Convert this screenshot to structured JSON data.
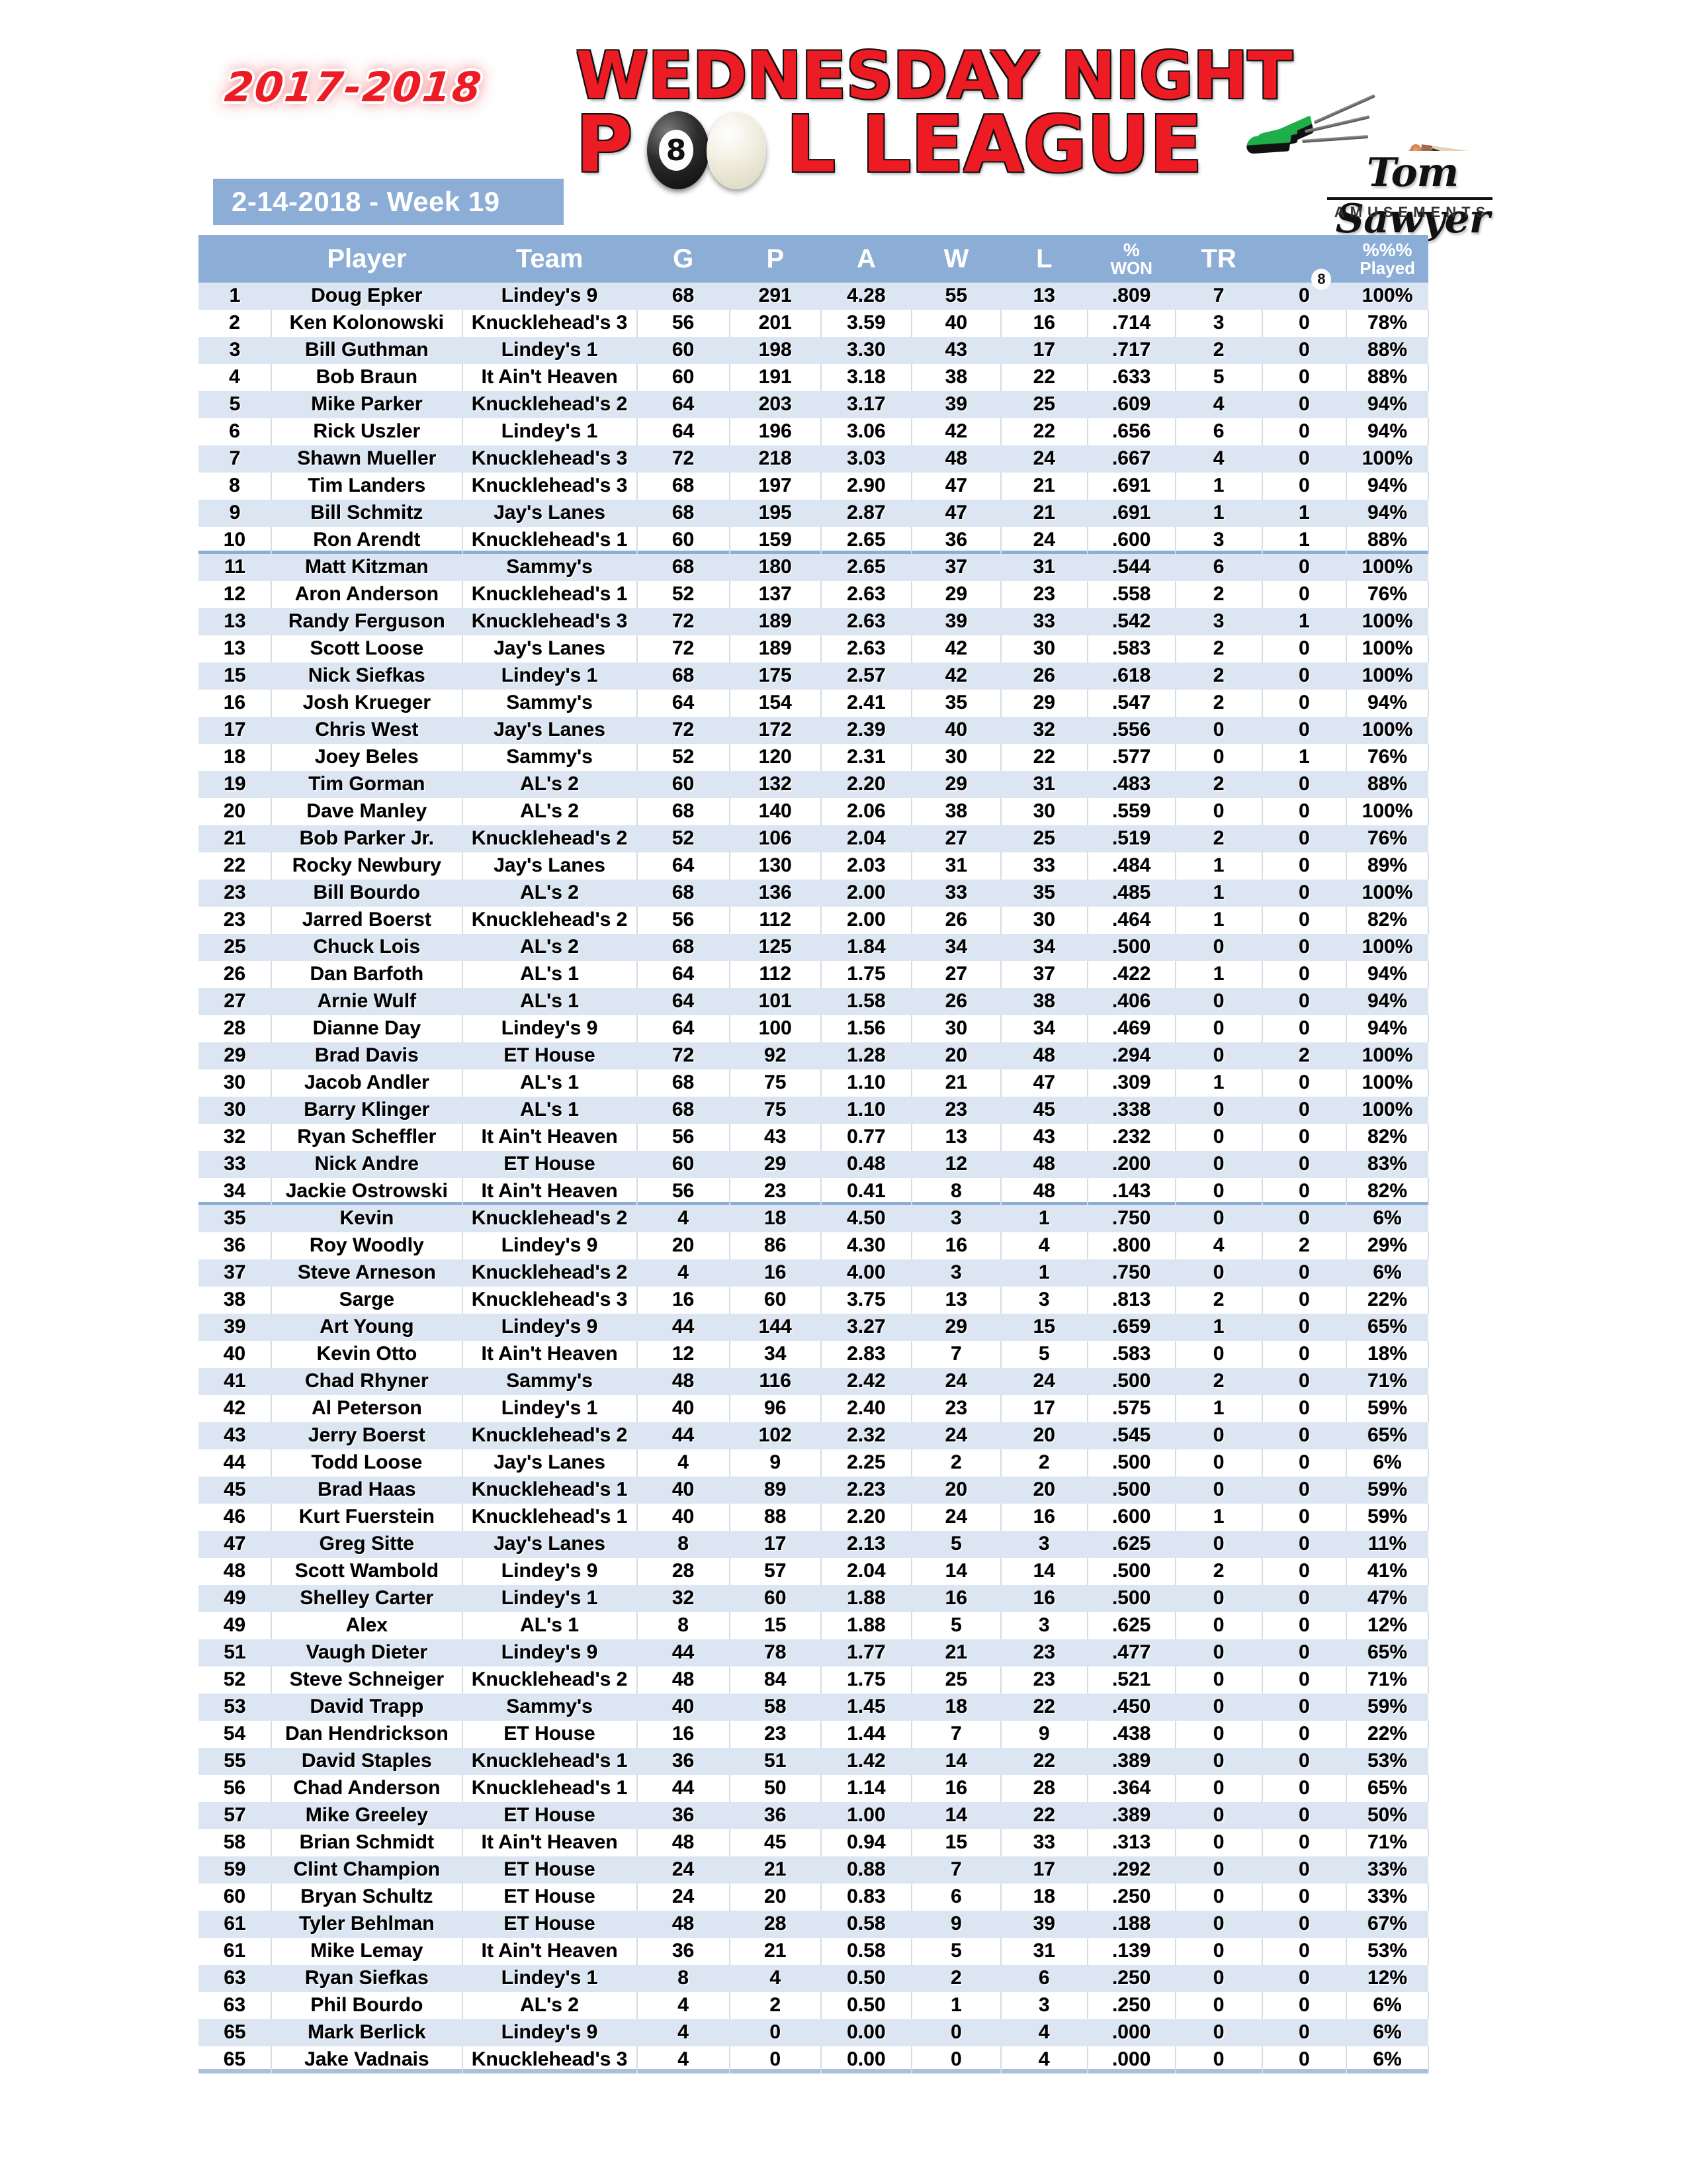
{
  "header": {
    "season": "2017-2018",
    "date_banner": "2-14-2018 - Week 19",
    "title_line1": "WEDNESDAY NIGHT",
    "title_p": "P",
    "title_l_league": "L LEAGUE",
    "eightball_number": "8",
    "logo": {
      "name": "Tom Sawyer",
      "subtitle": "AMUSEMENTS"
    },
    "colors": {
      "accent_red": "#ED1C24",
      "header_blue": "#8CAED6",
      "row_alt_blue": "#DCE6F2"
    }
  },
  "table": {
    "columns": [
      {
        "key": "rank",
        "label": ""
      },
      {
        "key": "player",
        "label": "Player"
      },
      {
        "key": "team",
        "label": "Team"
      },
      {
        "key": "g",
        "label": "G"
      },
      {
        "key": "p",
        "label": "P"
      },
      {
        "key": "a",
        "label": "A"
      },
      {
        "key": "w",
        "label": "W"
      },
      {
        "key": "l",
        "label": "L"
      },
      {
        "key": "won",
        "label_top": "%",
        "label_bottom": "WON"
      },
      {
        "key": "tr",
        "label": "TR"
      },
      {
        "key": "eb",
        "label": "8"
      },
      {
        "key": "pl",
        "label_top": "%%%",
        "label_bottom": "Played"
      }
    ],
    "rows": [
      {
        "rank": "1",
        "player": "Doug Epker",
        "team": "Lindey's 9",
        "g": "68",
        "p": "291",
        "a": "4.28",
        "w": "55",
        "l": "13",
        "won": ".809",
        "tr": "7",
        "eb": "0",
        "pl": "100%"
      },
      {
        "rank": "2",
        "player": "Ken Kolonowski",
        "team": "Knucklehead's 3",
        "g": "56",
        "p": "201",
        "a": "3.59",
        "w": "40",
        "l": "16",
        "won": ".714",
        "tr": "3",
        "eb": "0",
        "pl": "78%"
      },
      {
        "rank": "3",
        "player": "Bill Guthman",
        "team": "Lindey's 1",
        "g": "60",
        "p": "198",
        "a": "3.30",
        "w": "43",
        "l": "17",
        "won": ".717",
        "tr": "2",
        "eb": "0",
        "pl": "88%"
      },
      {
        "rank": "4",
        "player": "Bob Braun",
        "team": "It Ain't Heaven",
        "g": "60",
        "p": "191",
        "a": "3.18",
        "w": "38",
        "l": "22",
        "won": ".633",
        "tr": "5",
        "eb": "0",
        "pl": "88%"
      },
      {
        "rank": "5",
        "player": "Mike Parker",
        "team": "Knucklehead's 2",
        "g": "64",
        "p": "203",
        "a": "3.17",
        "w": "39",
        "l": "25",
        "won": ".609",
        "tr": "4",
        "eb": "0",
        "pl": "94%"
      },
      {
        "rank": "6",
        "player": "Rick Uszler",
        "team": "Lindey's 1",
        "g": "64",
        "p": "196",
        "a": "3.06",
        "w": "42",
        "l": "22",
        "won": ".656",
        "tr": "6",
        "eb": "0",
        "pl": "94%"
      },
      {
        "rank": "7",
        "player": "Shawn Mueller",
        "team": "Knucklehead's 3",
        "g": "72",
        "p": "218",
        "a": "3.03",
        "w": "48",
        "l": "24",
        "won": ".667",
        "tr": "4",
        "eb": "0",
        "pl": "100%"
      },
      {
        "rank": "8",
        "player": "Tim Landers",
        "team": "Knucklehead's 3",
        "g": "68",
        "p": "197",
        "a": "2.90",
        "w": "47",
        "l": "21",
        "won": ".691",
        "tr": "1",
        "eb": "0",
        "pl": "94%"
      },
      {
        "rank": "9",
        "player": "Bill Schmitz",
        "team": "Jay's Lanes",
        "g": "68",
        "p": "195",
        "a": "2.87",
        "w": "47",
        "l": "21",
        "won": ".691",
        "tr": "1",
        "eb": "1",
        "pl": "94%"
      },
      {
        "rank": "10",
        "player": "Ron Arendt",
        "team": "Knucklehead's 1",
        "g": "60",
        "p": "159",
        "a": "2.65",
        "w": "36",
        "l": "24",
        "won": ".600",
        "tr": "3",
        "eb": "1",
        "pl": "88%",
        "band_end": true
      },
      {
        "rank": "11",
        "player": "Matt Kitzman",
        "team": "Sammy's",
        "g": "68",
        "p": "180",
        "a": "2.65",
        "w": "37",
        "l": "31",
        "won": ".544",
        "tr": "6",
        "eb": "0",
        "pl": "100%"
      },
      {
        "rank": "12",
        "player": "Aron Anderson",
        "team": "Knucklehead's 1",
        "g": "52",
        "p": "137",
        "a": "2.63",
        "w": "29",
        "l": "23",
        "won": ".558",
        "tr": "2",
        "eb": "0",
        "pl": "76%"
      },
      {
        "rank": "13",
        "player": "Randy Ferguson",
        "team": "Knucklehead's 3",
        "g": "72",
        "p": "189",
        "a": "2.63",
        "w": "39",
        "l": "33",
        "won": ".542",
        "tr": "3",
        "eb": "1",
        "pl": "100%"
      },
      {
        "rank": "13",
        "player": "Scott Loose",
        "team": "Jay's Lanes",
        "g": "72",
        "p": "189",
        "a": "2.63",
        "w": "42",
        "l": "30",
        "won": ".583",
        "tr": "2",
        "eb": "0",
        "pl": "100%"
      },
      {
        "rank": "15",
        "player": "Nick Siefkas",
        "team": "Lindey's 1",
        "g": "68",
        "p": "175",
        "a": "2.57",
        "w": "42",
        "l": "26",
        "won": ".618",
        "tr": "2",
        "eb": "0",
        "pl": "100%"
      },
      {
        "rank": "16",
        "player": "Josh Krueger",
        "team": "Sammy's",
        "g": "64",
        "p": "154",
        "a": "2.41",
        "w": "35",
        "l": "29",
        "won": ".547",
        "tr": "2",
        "eb": "0",
        "pl": "94%"
      },
      {
        "rank": "17",
        "player": "Chris West",
        "team": "Jay's Lanes",
        "g": "72",
        "p": "172",
        "a": "2.39",
        "w": "40",
        "l": "32",
        "won": ".556",
        "tr": "0",
        "eb": "0",
        "pl": "100%"
      },
      {
        "rank": "18",
        "player": "Joey Beles",
        "team": "Sammy's",
        "g": "52",
        "p": "120",
        "a": "2.31",
        "w": "30",
        "l": "22",
        "won": ".577",
        "tr": "0",
        "eb": "1",
        "pl": "76%"
      },
      {
        "rank": "19",
        "player": "Tim Gorman",
        "team": "AL's 2",
        "g": "60",
        "p": "132",
        "a": "2.20",
        "w": "29",
        "l": "31",
        "won": ".483",
        "tr": "2",
        "eb": "0",
        "pl": "88%"
      },
      {
        "rank": "20",
        "player": "Dave Manley",
        "team": "AL's 2",
        "g": "68",
        "p": "140",
        "a": "2.06",
        "w": "38",
        "l": "30",
        "won": ".559",
        "tr": "0",
        "eb": "0",
        "pl": "100%"
      },
      {
        "rank": "21",
        "player": "Bob Parker Jr.",
        "team": "Knucklehead's 2",
        "g": "52",
        "p": "106",
        "a": "2.04",
        "w": "27",
        "l": "25",
        "won": ".519",
        "tr": "2",
        "eb": "0",
        "pl": "76%"
      },
      {
        "rank": "22",
        "player": "Rocky Newbury",
        "team": "Jay's Lanes",
        "g": "64",
        "p": "130",
        "a": "2.03",
        "w": "31",
        "l": "33",
        "won": ".484",
        "tr": "1",
        "eb": "0",
        "pl": "89%"
      },
      {
        "rank": "23",
        "player": "Bill Bourdo",
        "team": "AL's 2",
        "g": "68",
        "p": "136",
        "a": "2.00",
        "w": "33",
        "l": "35",
        "won": ".485",
        "tr": "1",
        "eb": "0",
        "pl": "100%"
      },
      {
        "rank": "23",
        "player": "Jarred Boerst",
        "team": "Knucklehead's 2",
        "g": "56",
        "p": "112",
        "a": "2.00",
        "w": "26",
        "l": "30",
        "won": ".464",
        "tr": "1",
        "eb": "0",
        "pl": "82%"
      },
      {
        "rank": "25",
        "player": "Chuck Lois",
        "team": "AL's 2",
        "g": "68",
        "p": "125",
        "a": "1.84",
        "w": "34",
        "l": "34",
        "won": ".500",
        "tr": "0",
        "eb": "0",
        "pl": "100%"
      },
      {
        "rank": "26",
        "player": "Dan Barfoth",
        "team": "AL's 1",
        "g": "64",
        "p": "112",
        "a": "1.75",
        "w": "27",
        "l": "37",
        "won": ".422",
        "tr": "1",
        "eb": "0",
        "pl": "94%"
      },
      {
        "rank": "27",
        "player": "Arnie Wulf",
        "team": "AL's 1",
        "g": "64",
        "p": "101",
        "a": "1.58",
        "w": "26",
        "l": "38",
        "won": ".406",
        "tr": "0",
        "eb": "0",
        "pl": "94%"
      },
      {
        "rank": "28",
        "player": "Dianne Day",
        "team": "Lindey's 9",
        "g": "64",
        "p": "100",
        "a": "1.56",
        "w": "30",
        "l": "34",
        "won": ".469",
        "tr": "0",
        "eb": "0",
        "pl": "94%"
      },
      {
        "rank": "29",
        "player": "Brad Davis",
        "team": "ET House",
        "g": "72",
        "p": "92",
        "a": "1.28",
        "w": "20",
        "l": "48",
        "won": ".294",
        "tr": "0",
        "eb": "2",
        "pl": "100%"
      },
      {
        "rank": "30",
        "player": "Jacob Andler",
        "team": "AL's 1",
        "g": "68",
        "p": "75",
        "a": "1.10",
        "w": "21",
        "l": "47",
        "won": ".309",
        "tr": "1",
        "eb": "0",
        "pl": "100%"
      },
      {
        "rank": "30",
        "player": "Barry Klinger",
        "team": "AL's 1",
        "g": "68",
        "p": "75",
        "a": "1.10",
        "w": "23",
        "l": "45",
        "won": ".338",
        "tr": "0",
        "eb": "0",
        "pl": "100%"
      },
      {
        "rank": "32",
        "player": "Ryan Scheffler",
        "team": "It Ain't Heaven",
        "g": "56",
        "p": "43",
        "a": "0.77",
        "w": "13",
        "l": "43",
        "won": ".232",
        "tr": "0",
        "eb": "0",
        "pl": "82%"
      },
      {
        "rank": "33",
        "player": "Nick Andre",
        "team": "ET House",
        "g": "60",
        "p": "29",
        "a": "0.48",
        "w": "12",
        "l": "48",
        "won": ".200",
        "tr": "0",
        "eb": "0",
        "pl": "83%"
      },
      {
        "rank": "34",
        "player": "Jackie Ostrowski",
        "team": "It Ain't Heaven",
        "g": "56",
        "p": "23",
        "a": "0.41",
        "w": "8",
        "l": "48",
        "won": ".143",
        "tr": "0",
        "eb": "0",
        "pl": "82%",
        "band_end": true
      },
      {
        "rank": "35",
        "player": "Kevin",
        "team": "Knucklehead's 2",
        "g": "4",
        "p": "18",
        "a": "4.50",
        "w": "3",
        "l": "1",
        "won": ".750",
        "tr": "0",
        "eb": "0",
        "pl": "6%"
      },
      {
        "rank": "36",
        "player": "Roy Woodly",
        "team": "Lindey's 9",
        "g": "20",
        "p": "86",
        "a": "4.30",
        "w": "16",
        "l": "4",
        "won": ".800",
        "tr": "4",
        "eb": "2",
        "pl": "29%"
      },
      {
        "rank": "37",
        "player": "Steve Arneson",
        "team": "Knucklehead's 2",
        "g": "4",
        "p": "16",
        "a": "4.00",
        "w": "3",
        "l": "1",
        "won": ".750",
        "tr": "0",
        "eb": "0",
        "pl": "6%"
      },
      {
        "rank": "38",
        "player": "Sarge",
        "team": "Knucklehead's 3",
        "g": "16",
        "p": "60",
        "a": "3.75",
        "w": "13",
        "l": "3",
        "won": ".813",
        "tr": "2",
        "eb": "0",
        "pl": "22%"
      },
      {
        "rank": "39",
        "player": "Art Young",
        "team": "Lindey's 9",
        "g": "44",
        "p": "144",
        "a": "3.27",
        "w": "29",
        "l": "15",
        "won": ".659",
        "tr": "1",
        "eb": "0",
        "pl": "65%"
      },
      {
        "rank": "40",
        "player": "Kevin Otto",
        "team": "It Ain't Heaven",
        "g": "12",
        "p": "34",
        "a": "2.83",
        "w": "7",
        "l": "5",
        "won": ".583",
        "tr": "0",
        "eb": "0",
        "pl": "18%"
      },
      {
        "rank": "41",
        "player": "Chad Rhyner",
        "team": "Sammy's",
        "g": "48",
        "p": "116",
        "a": "2.42",
        "w": "24",
        "l": "24",
        "won": ".500",
        "tr": "2",
        "eb": "0",
        "pl": "71%"
      },
      {
        "rank": "42",
        "player": "Al Peterson",
        "team": "Lindey's 1",
        "g": "40",
        "p": "96",
        "a": "2.40",
        "w": "23",
        "l": "17",
        "won": ".575",
        "tr": "1",
        "eb": "0",
        "pl": "59%"
      },
      {
        "rank": "43",
        "player": "Jerry Boerst",
        "team": "Knucklehead's 2",
        "g": "44",
        "p": "102",
        "a": "2.32",
        "w": "24",
        "l": "20",
        "won": ".545",
        "tr": "0",
        "eb": "0",
        "pl": "65%"
      },
      {
        "rank": "44",
        "player": "Todd Loose",
        "team": "Jay's Lanes",
        "g": "4",
        "p": "9",
        "a": "2.25",
        "w": "2",
        "l": "2",
        "won": ".500",
        "tr": "0",
        "eb": "0",
        "pl": "6%"
      },
      {
        "rank": "45",
        "player": "Brad Haas",
        "team": "Knucklehead's 1",
        "g": "40",
        "p": "89",
        "a": "2.23",
        "w": "20",
        "l": "20",
        "won": ".500",
        "tr": "0",
        "eb": "0",
        "pl": "59%"
      },
      {
        "rank": "46",
        "player": "Kurt Fuerstein",
        "team": "Knucklehead's 1",
        "g": "40",
        "p": "88",
        "a": "2.20",
        "w": "24",
        "l": "16",
        "won": ".600",
        "tr": "1",
        "eb": "0",
        "pl": "59%"
      },
      {
        "rank": "47",
        "player": "Greg Sitte",
        "team": "Jay's Lanes",
        "g": "8",
        "p": "17",
        "a": "2.13",
        "w": "5",
        "l": "3",
        "won": ".625",
        "tr": "0",
        "eb": "0",
        "pl": "11%"
      },
      {
        "rank": "48",
        "player": "Scott Wambold",
        "team": "Lindey's 9",
        "g": "28",
        "p": "57",
        "a": "2.04",
        "w": "14",
        "l": "14",
        "won": ".500",
        "tr": "2",
        "eb": "0",
        "pl": "41%"
      },
      {
        "rank": "49",
        "player": "Shelley Carter",
        "team": "Lindey's 1",
        "g": "32",
        "p": "60",
        "a": "1.88",
        "w": "16",
        "l": "16",
        "won": ".500",
        "tr": "0",
        "eb": "0",
        "pl": "47%"
      },
      {
        "rank": "49",
        "player": "Alex",
        "team": "AL's 1",
        "g": "8",
        "p": "15",
        "a": "1.88",
        "w": "5",
        "l": "3",
        "won": ".625",
        "tr": "0",
        "eb": "0",
        "pl": "12%"
      },
      {
        "rank": "51",
        "player": "Vaugh Dieter",
        "team": "Lindey's 9",
        "g": "44",
        "p": "78",
        "a": "1.77",
        "w": "21",
        "l": "23",
        "won": ".477",
        "tr": "0",
        "eb": "0",
        "pl": "65%"
      },
      {
        "rank": "52",
        "player": "Steve Schneiger",
        "team": "Knucklehead's 2",
        "g": "48",
        "p": "84",
        "a": "1.75",
        "w": "25",
        "l": "23",
        "won": ".521",
        "tr": "0",
        "eb": "0",
        "pl": "71%"
      },
      {
        "rank": "53",
        "player": "David Trapp",
        "team": "Sammy's",
        "g": "40",
        "p": "58",
        "a": "1.45",
        "w": "18",
        "l": "22",
        "won": ".450",
        "tr": "0",
        "eb": "0",
        "pl": "59%"
      },
      {
        "rank": "54",
        "player": "Dan Hendrickson",
        "team": "ET House",
        "g": "16",
        "p": "23",
        "a": "1.44",
        "w": "7",
        "l": "9",
        "won": ".438",
        "tr": "0",
        "eb": "0",
        "pl": "22%"
      },
      {
        "rank": "55",
        "player": "David Staples",
        "team": "Knucklehead's 1",
        "g": "36",
        "p": "51",
        "a": "1.42",
        "w": "14",
        "l": "22",
        "won": ".389",
        "tr": "0",
        "eb": "0",
        "pl": "53%"
      },
      {
        "rank": "56",
        "player": "Chad Anderson",
        "team": "Knucklehead's 1",
        "g": "44",
        "p": "50",
        "a": "1.14",
        "w": "16",
        "l": "28",
        "won": ".364",
        "tr": "0",
        "eb": "0",
        "pl": "65%"
      },
      {
        "rank": "57",
        "player": "Mike Greeley",
        "team": "ET House",
        "g": "36",
        "p": "36",
        "a": "1.00",
        "w": "14",
        "l": "22",
        "won": ".389",
        "tr": "0",
        "eb": "0",
        "pl": "50%"
      },
      {
        "rank": "58",
        "player": "Brian Schmidt",
        "team": "It Ain't Heaven",
        "g": "48",
        "p": "45",
        "a": "0.94",
        "w": "15",
        "l": "33",
        "won": ".313",
        "tr": "0",
        "eb": "0",
        "pl": "71%"
      },
      {
        "rank": "59",
        "player": "Clint Champion",
        "team": "ET House",
        "g": "24",
        "p": "21",
        "a": "0.88",
        "w": "7",
        "l": "17",
        "won": ".292",
        "tr": "0",
        "eb": "0",
        "pl": "33%"
      },
      {
        "rank": "60",
        "player": "Bryan Schultz",
        "team": "ET House",
        "g": "24",
        "p": "20",
        "a": "0.83",
        "w": "6",
        "l": "18",
        "won": ".250",
        "tr": "0",
        "eb": "0",
        "pl": "33%"
      },
      {
        "rank": "61",
        "player": "Tyler Behlman",
        "team": "ET House",
        "g": "48",
        "p": "28",
        "a": "0.58",
        "w": "9",
        "l": "39",
        "won": ".188",
        "tr": "0",
        "eb": "0",
        "pl": "67%"
      },
      {
        "rank": "61",
        "player": "Mike Lemay",
        "team": "It Ain't Heaven",
        "g": "36",
        "p": "21",
        "a": "0.58",
        "w": "5",
        "l": "31",
        "won": ".139",
        "tr": "0",
        "eb": "0",
        "pl": "53%"
      },
      {
        "rank": "63",
        "player": "Ryan Siefkas",
        "team": "Lindey's 1",
        "g": "8",
        "p": "4",
        "a": "0.50",
        "w": "2",
        "l": "6",
        "won": ".250",
        "tr": "0",
        "eb": "0",
        "pl": "12%"
      },
      {
        "rank": "63",
        "player": "Phil Bourdo",
        "team": "AL's 2",
        "g": "4",
        "p": "2",
        "a": "0.50",
        "w": "1",
        "l": "3",
        "won": ".250",
        "tr": "0",
        "eb": "0",
        "pl": "6%"
      },
      {
        "rank": "65",
        "player": "Mark Berlick",
        "team": "Lindey's 9",
        "g": "4",
        "p": "0",
        "a": "0.00",
        "w": "0",
        "l": "4",
        "won": ".000",
        "tr": "0",
        "eb": "0",
        "pl": "6%"
      },
      {
        "rank": "65",
        "player": "Jake Vadnais",
        "team": "Knucklehead's 3",
        "g": "4",
        "p": "0",
        "a": "0.00",
        "w": "0",
        "l": "4",
        "won": ".000",
        "tr": "0",
        "eb": "0",
        "pl": "6%"
      }
    ]
  }
}
